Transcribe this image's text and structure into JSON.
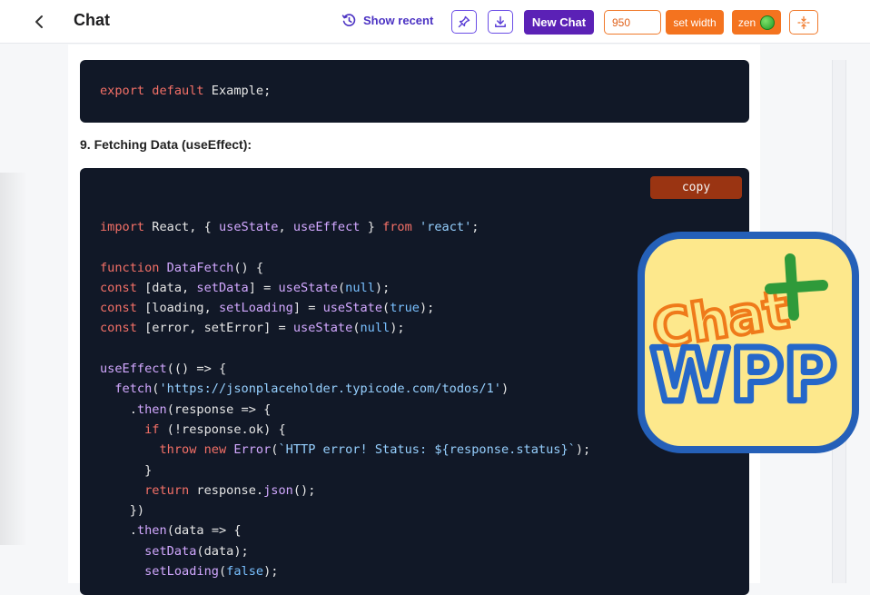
{
  "header": {
    "title": "Chat",
    "show_recent_label": "Show recent",
    "new_chat_label": "New Chat",
    "width_value": "950",
    "set_width_label": "set width",
    "zen_label": "zen"
  },
  "content": {
    "section_heading": "9. Fetching Data (useEffect):",
    "copy_label": "copy",
    "code_top": "export default Example;",
    "code_lines": [
      "import React, { useState, useEffect } from 'react';",
      "",
      "function DataFetch() {",
      "const [data, setData] = useState(null);",
      "const [loading, setLoading] = useState(true);",
      "const [error, setError] = useState(null);",
      "",
      "useEffect(() => {",
      "  fetch('https://jsonplaceholder.typicode.com/todos/1')",
      "    .then(response => {",
      "      if (!response.ok) {",
      "        throw new Error(`HTTP error! Status: ${response.status}`);",
      "      }",
      "      return response.json();",
      "    })",
      "    .then(data => {",
      "      setData(data);",
      "      setLoading(false);"
    ]
  },
  "logo": {
    "text_top": "Chat",
    "text_bottom": "WPP",
    "plus": "+"
  },
  "colors": {
    "accent_purple": "#5b21b6",
    "accent_orange": "#f4731f",
    "code_bg": "#111827",
    "keyword": "#f47067",
    "function": "#d2a8ff",
    "string": "#96d0ff"
  }
}
